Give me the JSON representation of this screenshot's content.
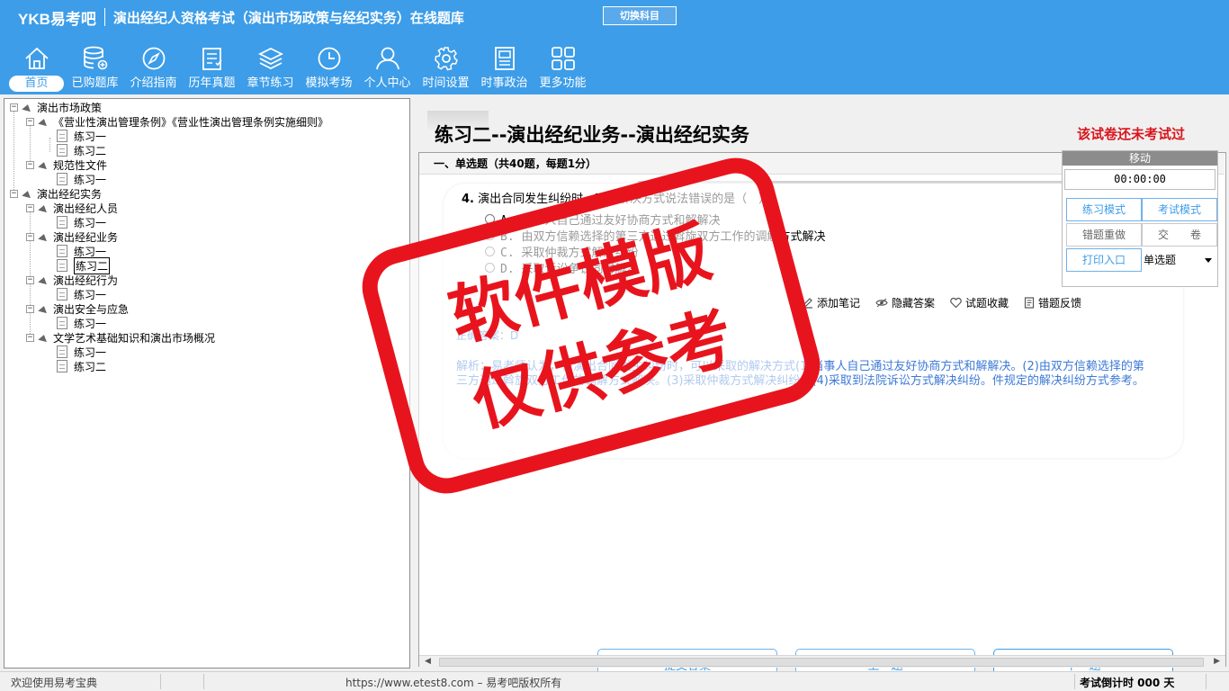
{
  "header": {
    "logo": "YKB易考吧",
    "title": "演出经纪人资格考试（演出市场政策与经纪实务）在线题库",
    "switch_label": "切换科目",
    "nav": [
      {
        "label": "首页",
        "icon": "home-icon",
        "active": true
      },
      {
        "label": "已购题库",
        "icon": "database-icon"
      },
      {
        "label": "介绍指南",
        "icon": "compass-icon"
      },
      {
        "label": "历年真题",
        "icon": "list-icon"
      },
      {
        "label": "章节练习",
        "icon": "layers-icon"
      },
      {
        "label": "模拟考场",
        "icon": "clock-icon"
      },
      {
        "label": "个人中心",
        "icon": "user-icon"
      },
      {
        "label": "时间设置",
        "icon": "gear-icon"
      },
      {
        "label": "时事政治",
        "icon": "news-icon"
      },
      {
        "label": "更多功能",
        "icon": "grid-icon"
      }
    ]
  },
  "tree": [
    {
      "label": "演出市场政策",
      "level": 0,
      "type": "folder"
    },
    {
      "label": "《营业性演出管理条例》《营业性演出管理条例实施细则》",
      "level": 1,
      "type": "folder"
    },
    {
      "label": "练习一",
      "level": 2,
      "type": "doc"
    },
    {
      "label": "练习二",
      "level": 2,
      "type": "doc"
    },
    {
      "label": "规范性文件",
      "level": 1,
      "type": "folder"
    },
    {
      "label": "练习一",
      "level": 2,
      "type": "doc"
    },
    {
      "label": "演出经纪实务",
      "level": 0,
      "type": "folder"
    },
    {
      "label": "演出经纪人员",
      "level": 1,
      "type": "folder"
    },
    {
      "label": "练习一",
      "level": 2,
      "type": "doc"
    },
    {
      "label": "演出经纪业务",
      "level": 1,
      "type": "folder"
    },
    {
      "label": "练习一",
      "level": 2,
      "type": "doc"
    },
    {
      "label": "练习二",
      "level": 2,
      "type": "doc",
      "selected": true
    },
    {
      "label": "演出经纪行为",
      "level": 1,
      "type": "folder"
    },
    {
      "label": "练习一",
      "level": 2,
      "type": "doc"
    },
    {
      "label": "演出安全与应急",
      "level": 1,
      "type": "folder"
    },
    {
      "label": "练习一",
      "level": 2,
      "type": "doc"
    },
    {
      "label": "文学艺术基础知识和演出市场概况",
      "level": 1,
      "type": "folder"
    },
    {
      "label": "练习一",
      "level": 2,
      "type": "doc"
    },
    {
      "label": "练习二",
      "level": 2,
      "type": "doc"
    }
  ],
  "paper": {
    "title": "练习二--演出经纪业务--演出经纪实务",
    "status": "该试卷还未考试过",
    "section": "一、单选题（共40题，每题1分）"
  },
  "question": {
    "number": "4.",
    "text": "演出合同发生纠纷时，下列解决方式说法错误的是（　）。",
    "options": [
      "A. 当事人自己通过友好协商方式和解解决",
      "B. 由双方信赖选择的第三方通过斡旋双方工作的调解方式解决",
      "C. 采取仲裁方式解决纠纷",
      "D. 采取诉讼争议同时解决"
    ],
    "actions": [
      {
        "label": "添加笔记",
        "icon": "pencil-icon"
      },
      {
        "label": "隐藏答案",
        "icon": "eye-icon"
      },
      {
        "label": "试题收藏",
        "icon": "heart-icon"
      },
      {
        "label": "错题反馈",
        "icon": "feedback-icon"
      }
    ],
    "answer": "正确答案：D",
    "explanation": "解析：易老师认为，在演出合同发生纠纷时，可以采取的解决方式(1)当事人自己通过友好协商方式和解解决。(2)由双方信赖选择的第三方通过斡旋双方工作的调解方式解决。(3)采取仲裁方式解决纠纷。(4)采取到法院诉讼方式解决纠纷。件规定的解决纠纷方式参考。"
  },
  "buttons": {
    "submit": "提交答案",
    "prev": "上一题",
    "next": "下一题"
  },
  "float_panel": {
    "title": "移动",
    "timer": "00:00:00",
    "practice_mode": "练习模式",
    "exam_mode": "考试模式",
    "redo_wrong": "错题重做",
    "hand_in": "交　　卷",
    "print": "打印入口",
    "type_select": "单选题"
  },
  "watermark": {
    "line1": "软件模版",
    "line2": "仅供参考"
  },
  "statusbar": {
    "welcome": "欢迎使用易考宝典",
    "copyright": "https://www.etest8.com – 易考吧版权所有",
    "countdown": "考试倒计时 000 天"
  },
  "colors": {
    "accent": "#3d9de8",
    "status_red": "#d9141b",
    "stamp_red": "#e8141d",
    "link_blue": "#3d7ad6"
  }
}
